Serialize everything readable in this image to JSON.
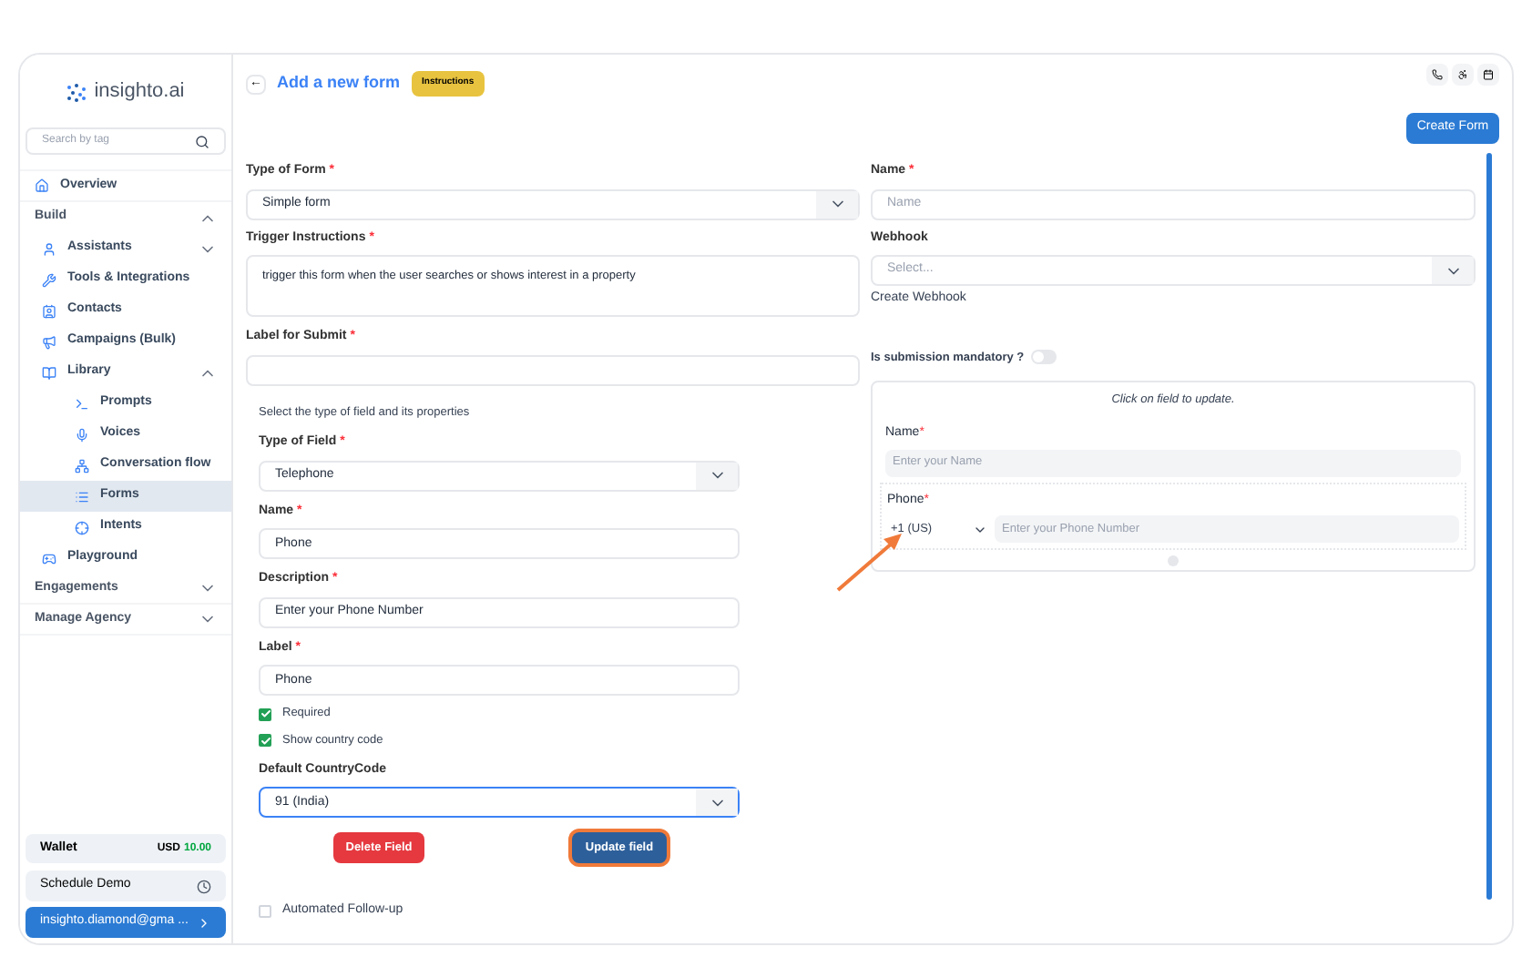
{
  "sidebar": {
    "logo": "insighto.ai",
    "search": {
      "placeholder": "Search by tag"
    },
    "items": [
      {
        "label": "Overview",
        "selected": false
      },
      {
        "label": "Build",
        "expanded": true,
        "children": [
          {
            "label": "Assistants",
            "expanded": false,
            "selected": false
          },
          {
            "label": "Tools & Integrations",
            "selected": false
          },
          {
            "label": "Contacts",
            "selected": false
          },
          {
            "label": "Campaigns (Bulk)",
            "selected": false
          },
          {
            "label": "Library",
            "expanded": true,
            "children": [
              {
                "label": "Prompts",
                "selected": false
              },
              {
                "label": "Voices",
                "selected": false
              },
              {
                "label": "Conversation flow",
                "selected": false
              },
              {
                "label": "Forms",
                "selected": true
              },
              {
                "label": "Intents",
                "selected": false
              }
            ]
          },
          {
            "label": "Playground",
            "selected": false
          }
        ]
      },
      {
        "label": "Engagements",
        "expanded": false
      },
      {
        "label": "Manage Agency",
        "expanded": false
      }
    ],
    "wallet": {
      "label": "Wallet",
      "currency": "USD",
      "amount": "10.00"
    },
    "schedule_demo": "Schedule Demo",
    "account": "insighto.diamond@gma ..."
  },
  "header": {
    "back": "←",
    "title": "Add a new form",
    "badge": "Instructions",
    "create_button": "Create Form"
  },
  "form": {
    "type_of_form": {
      "label": "Type of Form",
      "asterisk": "*",
      "value": "Simple form"
    },
    "trigger": {
      "label": "Trigger Instructions",
      "asterisk": "*",
      "value": "trigger this form when the user searches or shows interest in a property"
    },
    "submit_label": {
      "label": "Label for Submit",
      "asterisk": "*"
    },
    "name": {
      "label": "Name",
      "asterisk": "*",
      "placeholder": "Name"
    },
    "webhook": {
      "label": "Webhook",
      "placeholder": "Select...",
      "link": "Create Webhook"
    },
    "mandatory": {
      "label": "Is submission mandatory ?",
      "on": false
    }
  },
  "field_editor": {
    "intro": "Select the type of field and its properties",
    "type": {
      "label": "Type of Field",
      "asterisk": "*",
      "value": "Telephone"
    },
    "name": {
      "label": "Name",
      "asterisk": "*",
      "value": "Phone"
    },
    "description": {
      "label": "Description",
      "asterisk": "*",
      "value": "Enter your Phone Number"
    },
    "field_label": {
      "label": "Label",
      "asterisk": "*",
      "value": "Phone"
    },
    "checks": [
      {
        "label": "Required",
        "checked": true
      },
      {
        "label": "Show country code",
        "checked": true
      }
    ],
    "country": {
      "label": "Default CountryCode",
      "value": "91 (India)"
    },
    "delete_button": "Delete Field",
    "update_button": "Update field"
  },
  "followup": {
    "label": "Automated Follow-up",
    "checked": false
  },
  "preview": {
    "hint": "Click on field to update.",
    "fields": [
      {
        "kind": "text",
        "label": "Name",
        "asterisk": "*",
        "placeholder": "Enter your Name"
      },
      {
        "kind": "phone",
        "label": "Phone",
        "asterisk": "*",
        "code": "+1 (US)",
        "placeholder": "Enter your Phone Number"
      }
    ]
  }
}
